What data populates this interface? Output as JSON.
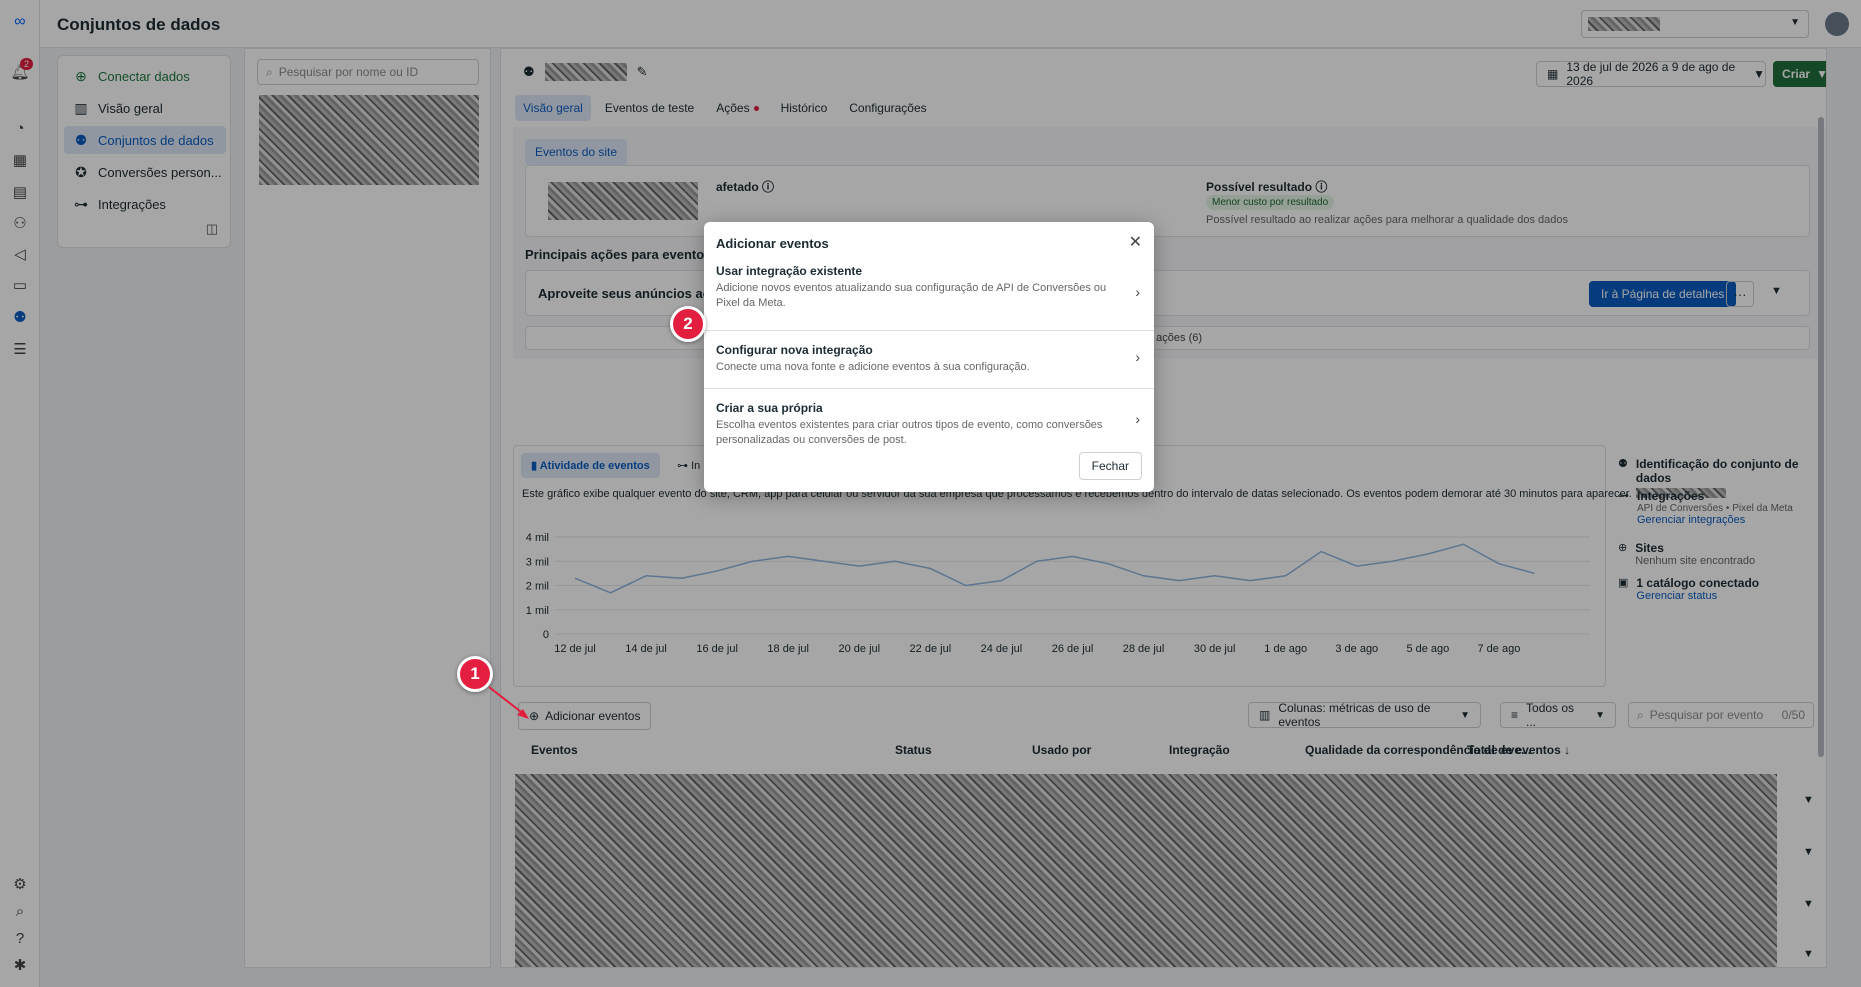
{
  "app": {
    "title": "Conjuntos de dados",
    "notification_count": "2"
  },
  "nav": {
    "connect": "Conectar dados",
    "items": [
      "Visão geral",
      "Conjuntos de dados",
      "Conversões person...",
      "Integrações"
    ]
  },
  "list": {
    "search_placeholder": "Pesquisar por nome ou ID"
  },
  "header": {
    "date_range": "13 de jul de 2026 a 9 de ago de 2026",
    "create": "Criar",
    "tabs": [
      "Visão geral",
      "Eventos de teste",
      "Ações",
      "Histórico",
      "Configurações"
    ]
  },
  "overview": {
    "site_events": "Eventos do site",
    "affected": "afetado",
    "possible_result": "Possível resultado",
    "tag": "Menor custo por resultado",
    "possible_result_desc": "Possível resultado ao realizar ações para melhorar a qualidade dos dados",
    "main_actions": "Principais ações para eventos de",
    "leverage": "Aproveite seus anúncios ao má",
    "details_button": "Ir à Página de detalhes",
    "all_actions": "s as ações (6)"
  },
  "activity": {
    "tab": "Atividade de eventos",
    "tab2": "In",
    "desc": "Este gráfico exibe qualquer evento do site, CRM, app para celular ou servidor da sua empresa que processamos e recebemos dentro do intervalo de datas selecionado. Os eventos podem demorar até 30 minutos para aparecer."
  },
  "chart_data": {
    "type": "line",
    "x": [
      "12 de jul",
      "13 de jul",
      "14 de jul",
      "15 de jul",
      "16 de jul",
      "17 de jul",
      "18 de jul",
      "19 de jul",
      "20 de jul",
      "21 de jul",
      "22 de jul",
      "23 de jul",
      "24 de jul",
      "25 de jul",
      "26 de jul",
      "27 de jul",
      "28 de jul",
      "29 de jul",
      "30 de jul",
      "31 de jul",
      "1 de ago",
      "2 de ago",
      "3 de ago",
      "4 de ago",
      "5 de ago",
      "6 de ago",
      "7 de ago",
      "8 de ago",
      "9 de ago"
    ],
    "xticks": [
      "12 de jul",
      "14 de jul",
      "16 de jul",
      "18 de jul",
      "20 de jul",
      "22 de jul",
      "24 de jul",
      "26 de jul",
      "28 de jul",
      "30 de jul",
      "1 de ago",
      "3 de ago",
      "5 de ago",
      "7 de ago"
    ],
    "yticks": [
      "4 mil",
      "3 mil",
      "2 mil",
      "1 mil",
      "0"
    ],
    "series": [
      {
        "values": [
          2300,
          1700,
          2400,
          2300,
          2600,
          3000,
          3200,
          3000,
          2800,
          3000,
          2700,
          2000,
          2200,
          3000,
          3200,
          2900,
          2400,
          2200,
          2400,
          2200,
          2400,
          3400,
          2800,
          3000,
          3300,
          3700,
          2900,
          2500
        ]
      }
    ],
    "ylim": [
      0,
      4000
    ],
    "grid": true
  },
  "side": {
    "id_title": "Identificação do conjunto de dados",
    "integrations_title": "Integrações",
    "integrations_desc": "API de Conversões • Pixel da Meta",
    "manage_integrations": "Gerenciar integrações",
    "sites_title": "Sites",
    "sites_desc": "Nenhum site encontrado",
    "catalog_title": "1 catálogo conectado",
    "manage_status": "Gerenciar status"
  },
  "table": {
    "add_events": "Adicionar eventos",
    "columns": "Colunas: métricas de uso de eventos",
    "filter": "Todos os ...",
    "search_placeholder": "Pesquisar por evento",
    "search_count": "0/50",
    "headers": [
      "Eventos",
      "Status",
      "Usado por",
      "Integração",
      "Qualidade da correspondência de eve...",
      "Total de eventos ↓"
    ]
  },
  "modal": {
    "title": "Adicionar eventos",
    "options": [
      {
        "title": "Usar integração existente",
        "desc": "Adicione novos eventos atualizando sua configuração de API de Conversões ou Pixel da Meta."
      },
      {
        "title": "Configurar nova integração",
        "desc": "Conecte uma nova fonte e adicione eventos à sua configuração."
      },
      {
        "title": "Criar a sua própria",
        "desc": "Escolha eventos existentes para criar outros tipos de evento, como conversões personalizadas ou conversões de post."
      }
    ],
    "close_button": "Fechar"
  },
  "callouts": [
    "1",
    "2"
  ],
  "colors": {
    "accent": "#0a5dc2",
    "create": "#1f6f3d",
    "callout": "#e41e3f"
  }
}
